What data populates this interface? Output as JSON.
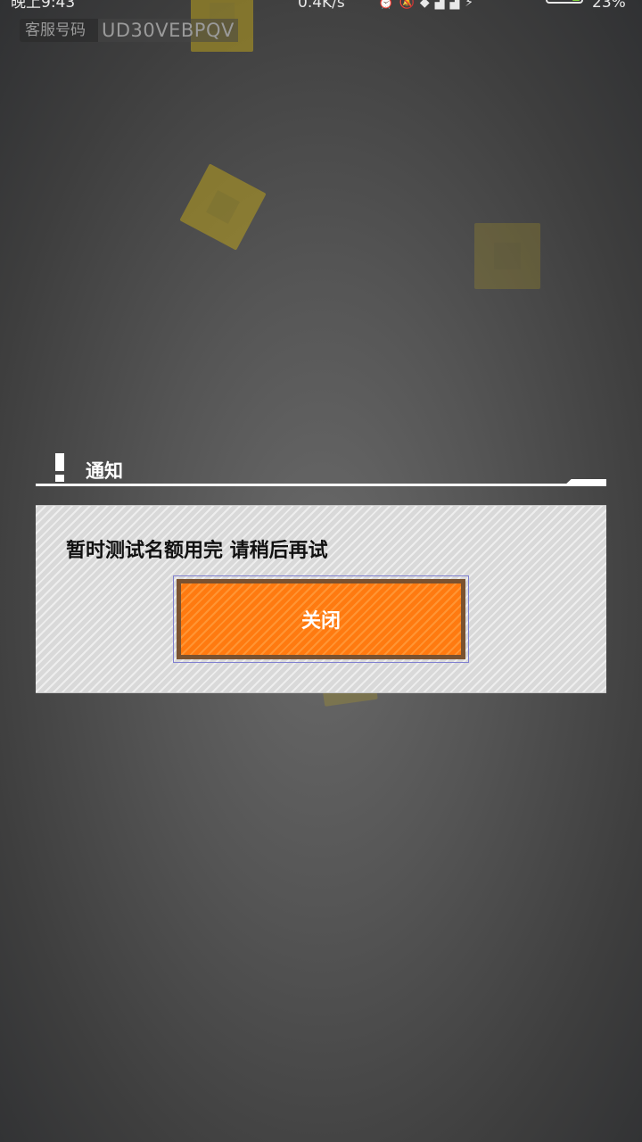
{
  "status_bar": {
    "time": "晚上9:43",
    "speed": "0.4K/s",
    "icons": [
      "alarm-icon",
      "mute-icon",
      "wifi-icon",
      "signal-icon",
      "signal-icon",
      "charging-icon"
    ],
    "battery_percent": "23%",
    "battery_level": 0.23,
    "battery_color": "#7fd23c"
  },
  "customer_service": {
    "label": "客服号码",
    "value": "UD30VEBPQV"
  },
  "notice": {
    "title": "通知"
  },
  "dialog": {
    "message": "暂时测试名额用完  请稍后再试",
    "close_label": "关闭",
    "accent_color": "#ff7a10"
  }
}
